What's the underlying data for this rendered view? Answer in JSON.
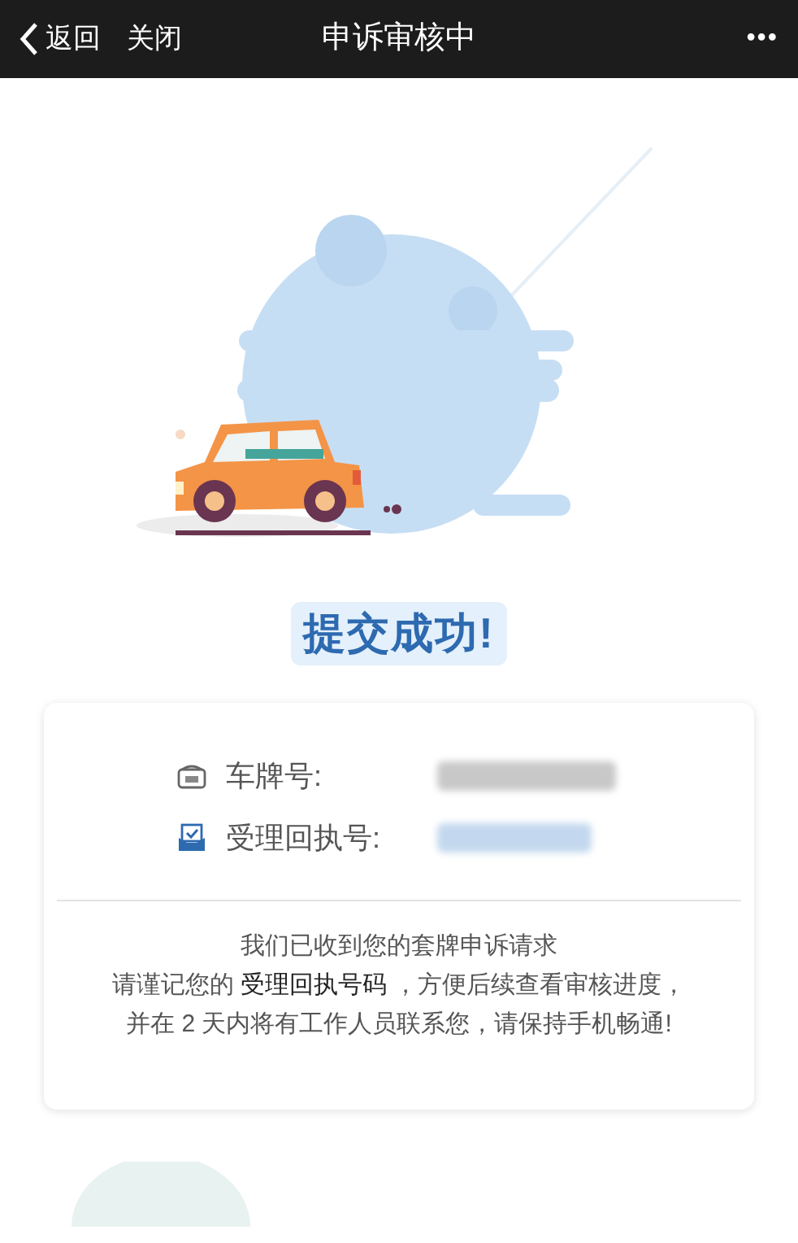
{
  "nav": {
    "back": "返回",
    "close": "关闭",
    "title": "申诉审核中",
    "more": "•••"
  },
  "result_title": "提交成功!",
  "info_rows": [
    {
      "kind": "plate",
      "label": "车牌号:"
    },
    {
      "kind": "receipt",
      "label": "受理回执号:"
    }
  ],
  "message_lines": [
    "我们已收到您的套牌申诉请求",
    "请谨记您的 **受理回执号码** ，方便后续查看审核进度，",
    "并在 2 天内将有工作人员联系您，请保持手机畅通!"
  ]
}
